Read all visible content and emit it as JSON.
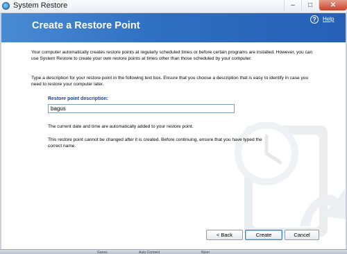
{
  "window": {
    "title": "System Restore",
    "controls": {
      "minimize": "–",
      "maximize": "□",
      "close": "✕"
    }
  },
  "header": {
    "title": "Create a Restore Point",
    "help_icon_glyph": "?",
    "help_label": "Help"
  },
  "content": {
    "intro": "Your computer automatically creates restore points at regularly scheduled times or before certain programs are installed. However, you can use System Restore to create your own restore points at times other than those scheduled by your computer.",
    "instructions": "Type a description for your restore point in the following text box. Ensure that you choose a description that is easy to identify in case you need to restore your computer later.",
    "field_label": "Restore point description:",
    "field_value": "bagus",
    "datetime_note": "The current date and time are automatically added to your restore point.",
    "warning": "This restore point cannot be changed after it is created. Before continuing, ensure that you have typed the correct name."
  },
  "buttons": {
    "back": "< Back",
    "create": "Create",
    "cancel": "Cancel"
  },
  "taskbar": {
    "items": [
      "Ganes",
      "Auto Connect",
      "Noori"
    ]
  },
  "colors": {
    "header_blue": "#2f6fc2",
    "label_blue": "#1d3f8e"
  }
}
